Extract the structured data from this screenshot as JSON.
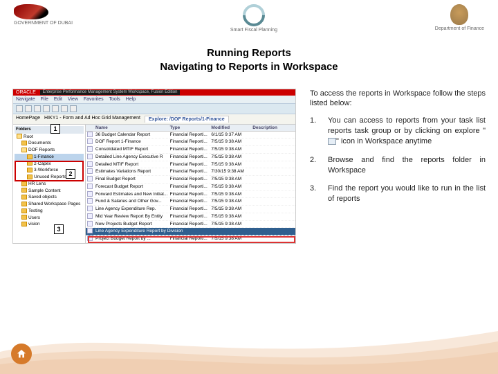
{
  "header": {
    "left_caption": "GOVERNMENT OF DUBAI",
    "center_caption": "Smart Fiscal Planning",
    "right_caption": "Department of Finance"
  },
  "title": {
    "line1": "Running Reports",
    "line2": "Navigating to Reports in Workspace"
  },
  "app": {
    "brand": "ORACLE",
    "suite": "Enterprise Performance Management System Workspace, Fusion Edition",
    "menu": [
      "Navigate",
      "File",
      "Edit",
      "View",
      "Favorites",
      "Tools",
      "Help"
    ],
    "tabs": {
      "left": "HomePage",
      "left2": "HIKY1 - Form and Ad Hoc Grid Management",
      "active": "Explore: /DOF Reports/1-Finance"
    },
    "tree": {
      "heading": "Folders",
      "items": [
        {
          "depth": 0,
          "label": "Root",
          "open": true
        },
        {
          "depth": 1,
          "label": "Documents"
        },
        {
          "depth": 1,
          "label": "DOF Reports",
          "open": true,
          "sel": false
        },
        {
          "depth": 2,
          "label": "1-Finance",
          "sel": true
        },
        {
          "depth": 2,
          "label": "2-Capex"
        },
        {
          "depth": 2,
          "label": "3-Workforce"
        },
        {
          "depth": 2,
          "label": "Unused Reports"
        },
        {
          "depth": 1,
          "label": "HR Lens"
        },
        {
          "depth": 1,
          "label": "Sample Content"
        },
        {
          "depth": 1,
          "label": "Saved objects"
        },
        {
          "depth": 1,
          "label": "Shared Workspace Pages"
        },
        {
          "depth": 1,
          "label": "Testing"
        },
        {
          "depth": 1,
          "label": "Users"
        },
        {
          "depth": 1,
          "label": "vision"
        }
      ]
    },
    "list": {
      "cols": [
        "",
        "Name",
        "Type",
        "Modified",
        "Description"
      ],
      "rows": [
        {
          "name": "36 Budget Calendar Report",
          "type": "Financial Reporti...",
          "mod": "6/1/15 9:37 AM"
        },
        {
          "name": "DOF Report 1-Finance",
          "type": "Financial Reporti...",
          "mod": "7/5/15 9:38 AM"
        },
        {
          "name": "Consolidated MTIF Report",
          "type": "Financial Reporti...",
          "mod": "7/5/15 9:38 AM"
        },
        {
          "name": "Detailed Line Agency Executive R",
          "type": "Financial Reporti...",
          "mod": "7/5/15 9:38 AM"
        },
        {
          "name": "Detailed MTIF Report",
          "type": "Financial Reporti...",
          "mod": "7/5/15 9:38 AM"
        },
        {
          "name": "Estimates Variations Report",
          "type": "Financial Reporti...",
          "mod": "7/30/15 9:38 AM"
        },
        {
          "name": "Final Budget Report",
          "type": "Financial Reporti...",
          "mod": "7/5/15 9:38 AM"
        },
        {
          "name": "Forecast Budget Report",
          "type": "Financial Reporti...",
          "mod": "7/5/15 9:38 AM"
        },
        {
          "name": "Forward Estimates and New Initiat...",
          "type": "Financial Reporti...",
          "mod": "7/5/15 9:38 AM"
        },
        {
          "name": "Fund & Salaries and Other Gov...",
          "type": "Financial Reporti...",
          "mod": "7/5/15 9:38 AM"
        },
        {
          "name": "Line Agency Expenditure Rep.",
          "type": "Financial Reporti...",
          "mod": "7/5/15 9:38 AM"
        },
        {
          "name": "Mid Year Review Report By Entity",
          "type": "Financial Reporti...",
          "mod": "7/5/15 9:38 AM"
        },
        {
          "name": "New Projects Budget Report",
          "type": "Financial Reporti...",
          "mod": "7/5/15 9:38 AM"
        },
        {
          "name": "Line Agency Expenditure Report by Division",
          "type": "",
          "mod": "",
          "selected": true
        },
        {
          "name": "Project Budget Report by ...",
          "type": "Financial Reporti...",
          "mod": "7/5/15 9:38 AM"
        }
      ]
    }
  },
  "callouts": {
    "c1": "1",
    "c2": "2",
    "c3": "3"
  },
  "instructions": {
    "intro": "To access the reports in Workspace follow the steps listed below:",
    "items": [
      {
        "num": "1.",
        "pre": "You can access to reports from your task list reports task group or by clicking on explore \"",
        "post": "\" icon in Workspace anytime"
      },
      {
        "num": "2.",
        "text": "Browse and find the reports folder in Workspace"
      },
      {
        "num": "3.",
        "text": "Find the report you would like to run in the list of reports"
      }
    ]
  }
}
